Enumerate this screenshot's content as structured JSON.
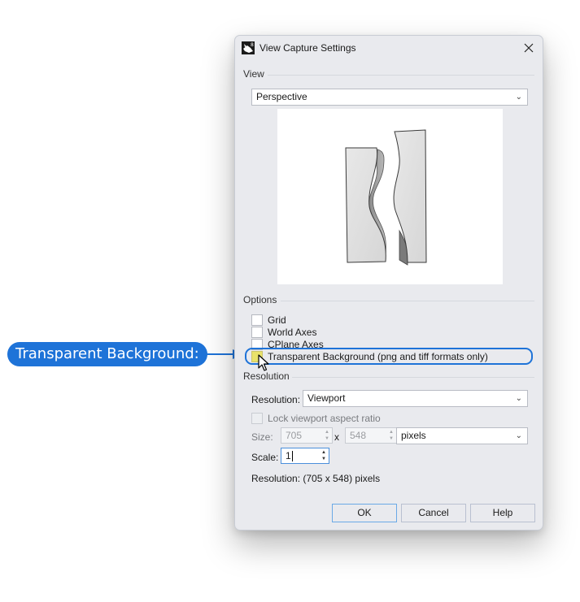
{
  "dialog": {
    "title": "View Capture Settings",
    "app_icon": "rhino-app-icon",
    "close_icon": "close-icon"
  },
  "view": {
    "group_label": "View",
    "selected": "Perspective",
    "preview_alt": "Perspective viewport preview of two wavy extruded panels"
  },
  "options": {
    "group_label": "Options",
    "checkboxes": [
      {
        "label": "Grid",
        "checked": false
      },
      {
        "label": "World Axes",
        "checked": false
      },
      {
        "label": "CPlane Axes",
        "checked": false
      },
      {
        "label": "Transparent Background (png and tiff formats only)",
        "checked": false,
        "highlighted": true
      }
    ]
  },
  "resolution": {
    "group_label": "Resolution",
    "resolution_label": "Resolution:",
    "resolution_selected": "Viewport",
    "lock_aspect_label": "Lock viewport aspect ratio",
    "lock_aspect_checked": false,
    "size_label": "Size:",
    "width": "705",
    "x_label": "x",
    "height": "548",
    "units_selected": "pixels",
    "scale_label": "Scale:",
    "scale": "1",
    "summary": "Resolution:  (705 x 548) pixels"
  },
  "buttons": {
    "ok": "OK",
    "cancel": "Cancel",
    "help": "Help"
  },
  "annotation": {
    "callout_text": "Transparent Background:",
    "color": "#1e73d8",
    "highlight_color": "#e9e26a"
  }
}
